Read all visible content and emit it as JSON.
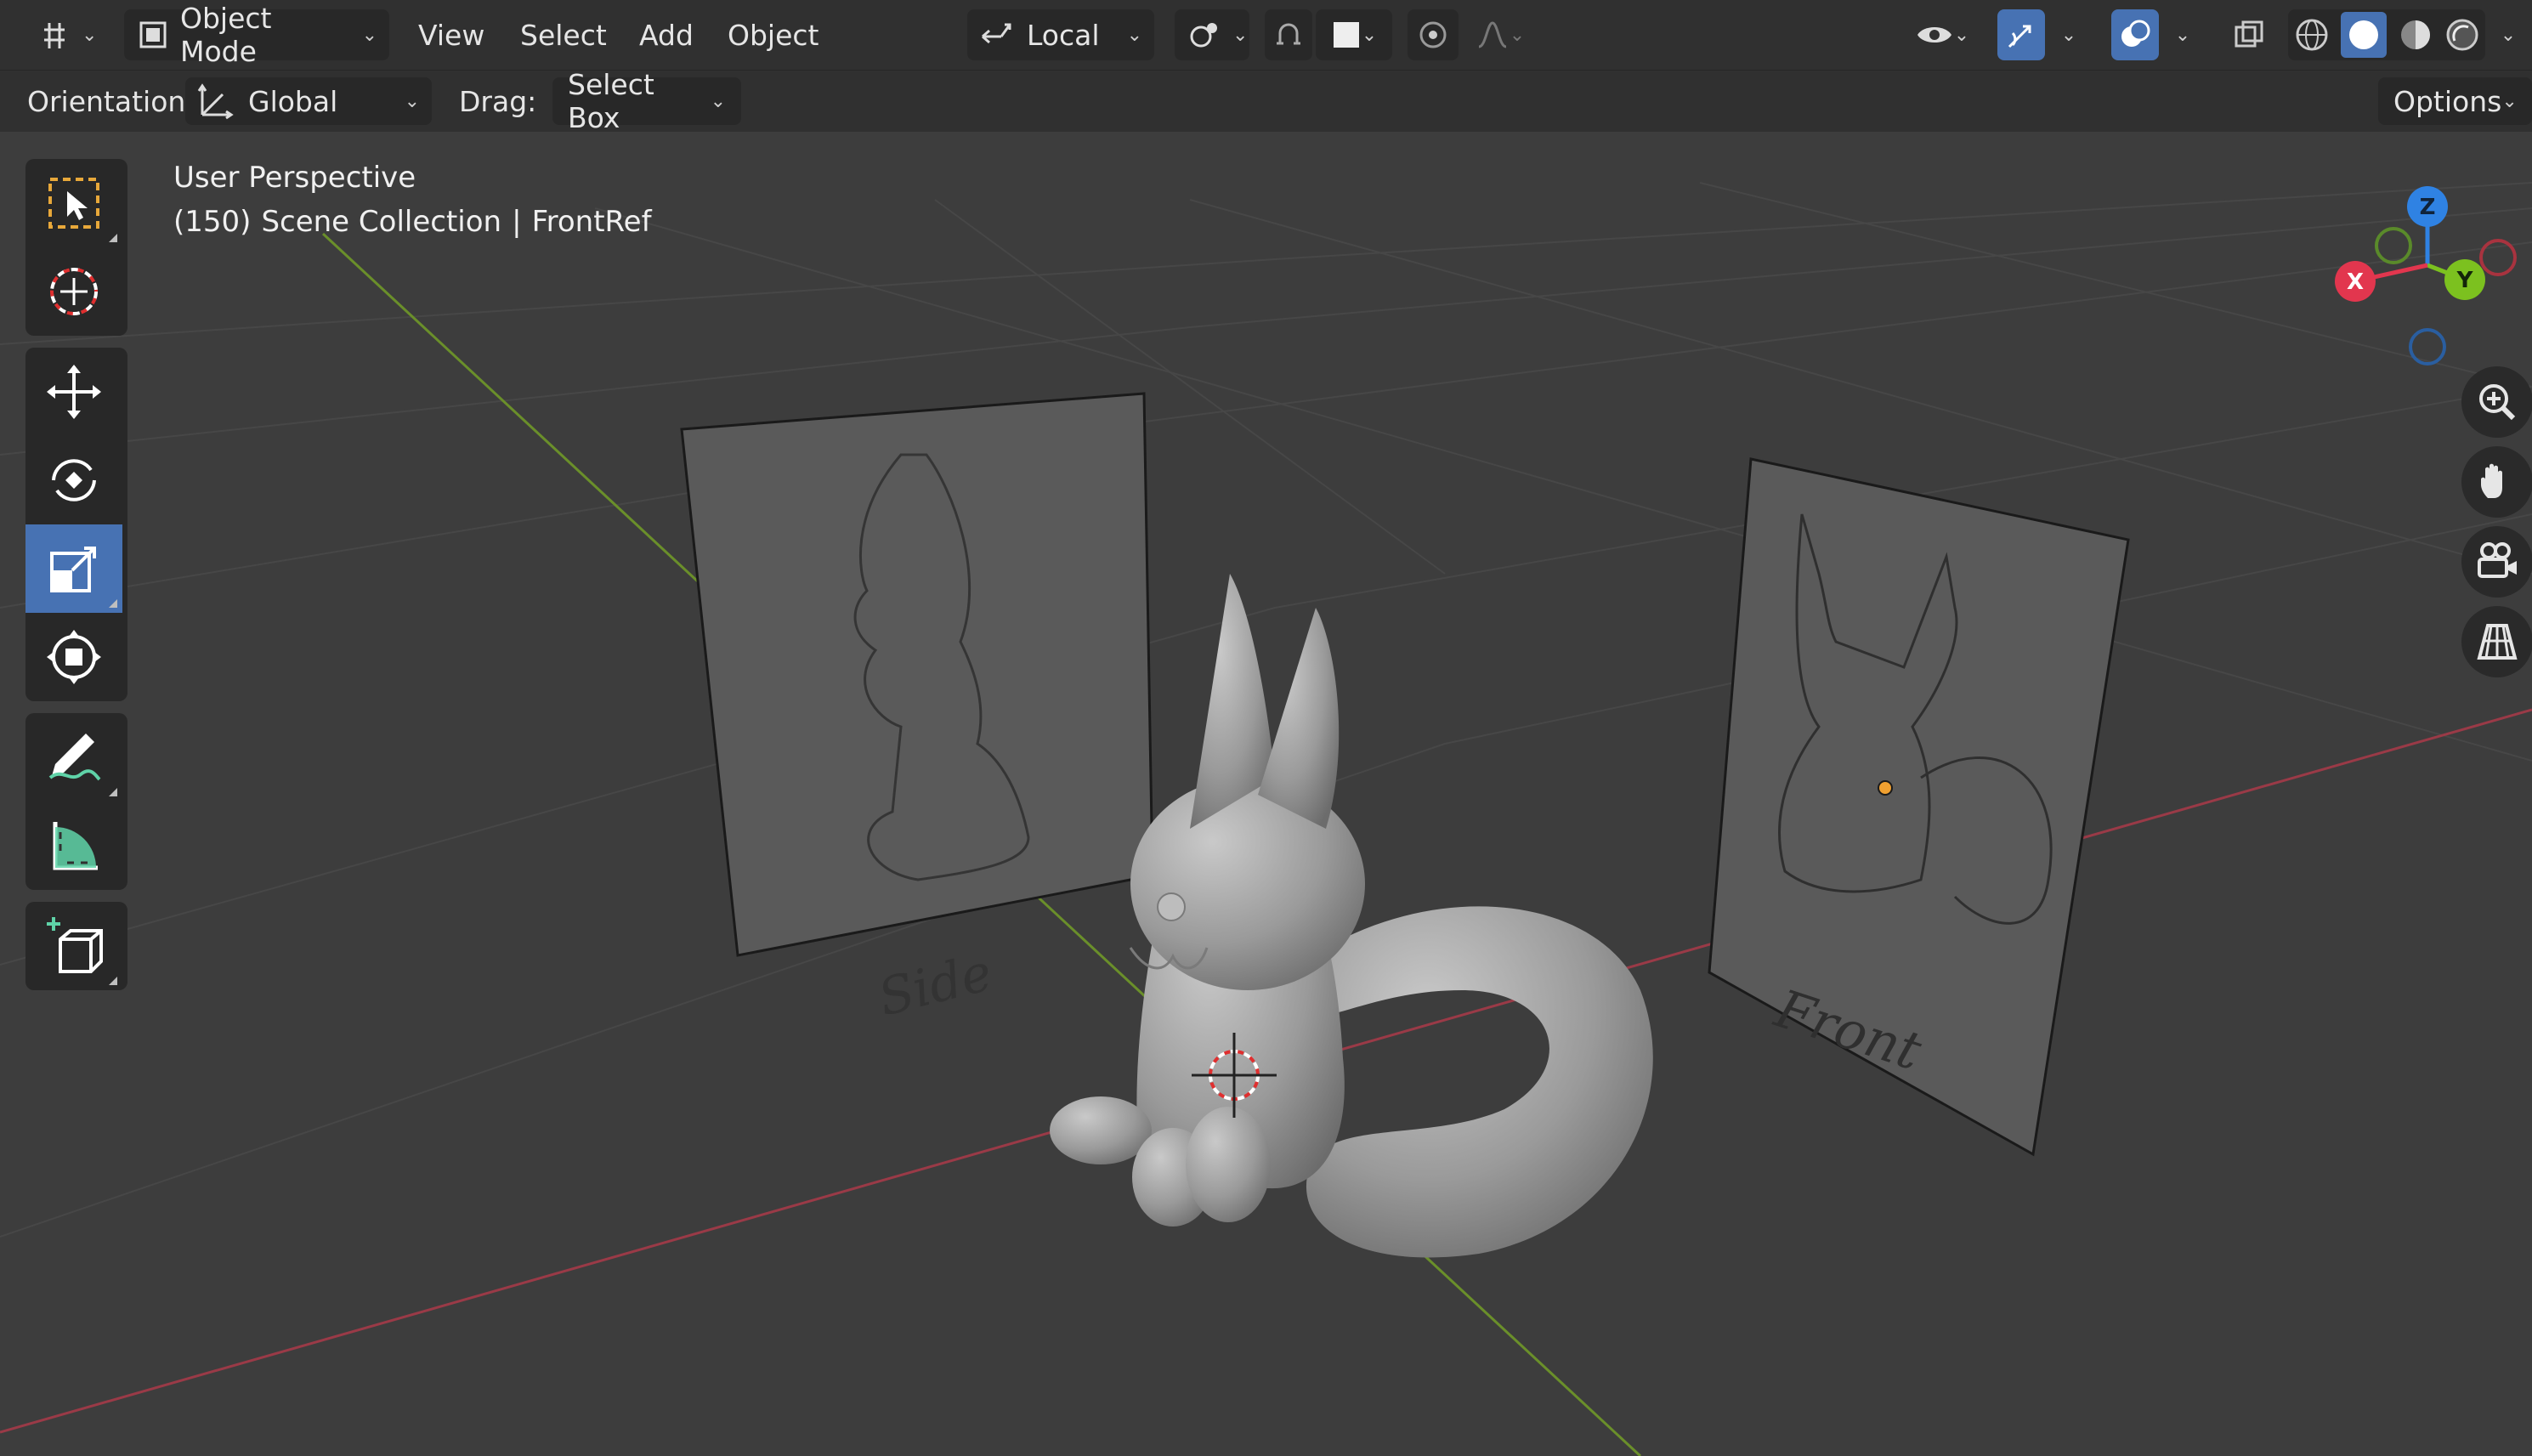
{
  "header": {
    "mode_label": "Object Mode",
    "menus": [
      "View",
      "Select",
      "Add",
      "Object"
    ],
    "pivot_label": "Local",
    "icons": {
      "editor_type": "editor-type-icon",
      "mode": "object-mode-icon",
      "transform_orientation": "transform-orientation-icon",
      "pivot": "pivot-point-icon",
      "snap": "snap-icon",
      "snap_target": "snap-target-icon",
      "proportional": "proportional-edit-icon",
      "falloff": "falloff-curve-icon",
      "visibility": "eye-icon",
      "gizmo": "gizmo-icon",
      "overlays": "overlays-icon",
      "xray": "xray-icon",
      "shading": [
        "wireframe-shading-icon",
        "solid-shading-icon",
        "material-preview-icon",
        "rendered-shading-icon"
      ]
    }
  },
  "tool_settings": {
    "orientation_label": "Orientation:",
    "orientation_value": "Global",
    "drag_label": "Drag:",
    "drag_value": "Select Box",
    "options_label": "Options"
  },
  "toolbar": {
    "tools": [
      {
        "name": "select-box",
        "icon": "select-box-icon",
        "active": false
      },
      {
        "name": "cursor",
        "icon": "cursor-icon",
        "active": false
      },
      {
        "name": "move",
        "icon": "move-icon",
        "active": false
      },
      {
        "name": "rotate",
        "icon": "rotate-icon",
        "active": false
      },
      {
        "name": "scale",
        "icon": "scale-icon",
        "active": true
      },
      {
        "name": "transform",
        "icon": "transform-icon",
        "active": false
      },
      {
        "name": "annotate",
        "icon": "annotate-icon",
        "active": false
      },
      {
        "name": "measure",
        "icon": "measure-icon",
        "active": false
      },
      {
        "name": "add-cube",
        "icon": "add-cube-icon",
        "active": false
      }
    ]
  },
  "viewport": {
    "view_name": "User Perspective",
    "frame": "(150)",
    "collection": "Scene Collection",
    "active_object": "FrontRef",
    "gizmo_axes": [
      "X",
      "Y",
      "Z"
    ],
    "side_sketch_text": "Side",
    "front_sketch_text": "Front",
    "nav_icons": [
      "zoom-icon",
      "pan-hand-icon",
      "camera-icon",
      "perspective-grid-icon"
    ]
  },
  "colors": {
    "accent": "#4772b3",
    "x_axis": "#e2364e",
    "y_axis": "#7cc11f",
    "z_axis": "#2f82e3",
    "origin": "#f0a030"
  }
}
